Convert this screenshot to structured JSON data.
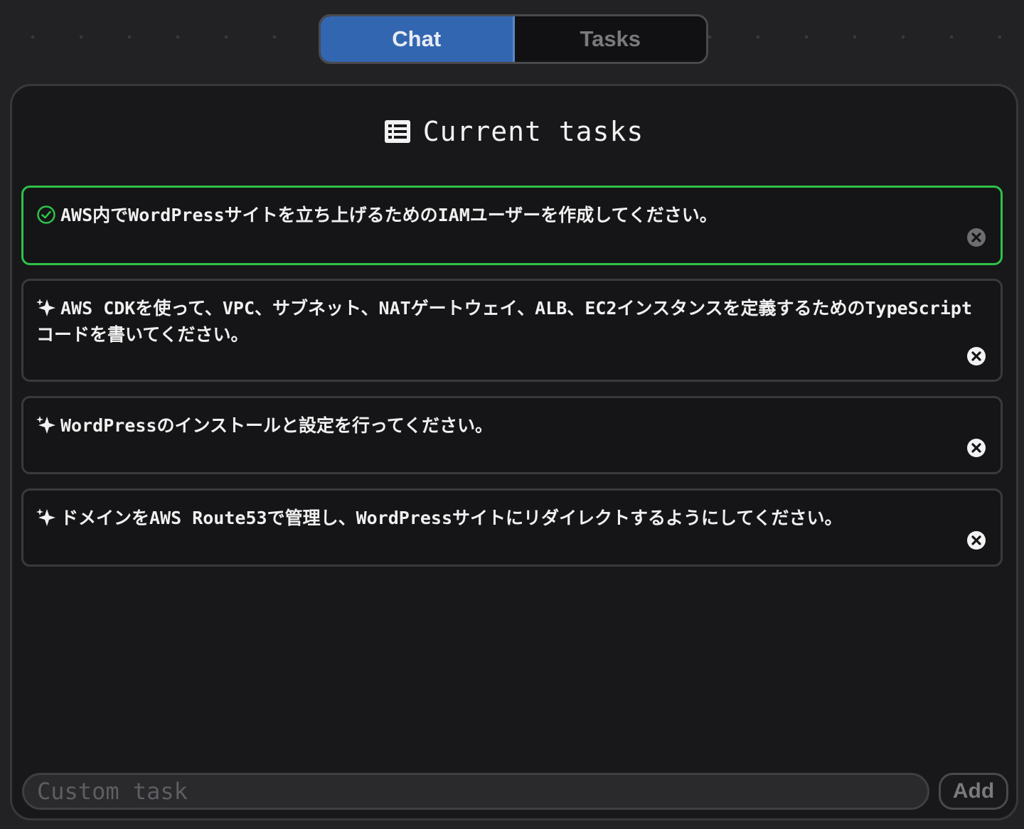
{
  "tabs": {
    "chat_label": "Chat",
    "tasks_label": "Tasks",
    "active": "chat"
  },
  "panel": {
    "title": "Current tasks",
    "title_icon": "list-icon"
  },
  "tasks": [
    {
      "status": "completed",
      "status_icon": "check-circle-icon",
      "text": "AWS内でWordPressサイトを立ち上げるためのIAMユーザーを作成してください。"
    },
    {
      "status": "pending",
      "status_icon": "sparkle-icon",
      "text": "AWS CDKを使って、VPC、サブネット、NATゲートウェイ、ALB、EC2インスタンスを定義するためのTypeScriptコードを書いてください。"
    },
    {
      "status": "pending",
      "status_icon": "sparkle-icon",
      "text": "WordPressのインストールと設定を行ってください。"
    },
    {
      "status": "pending",
      "status_icon": "sparkle-icon",
      "text": "ドメインをAWS Route53で管理し、WordPressサイトにリダイレクトするようにしてください。"
    }
  ],
  "footer": {
    "input_placeholder": "Custom task",
    "input_value": "",
    "add_label": "Add"
  },
  "colors": {
    "accent": "#3366b0",
    "completed_border": "#2ec24a",
    "background": "#18181a"
  }
}
